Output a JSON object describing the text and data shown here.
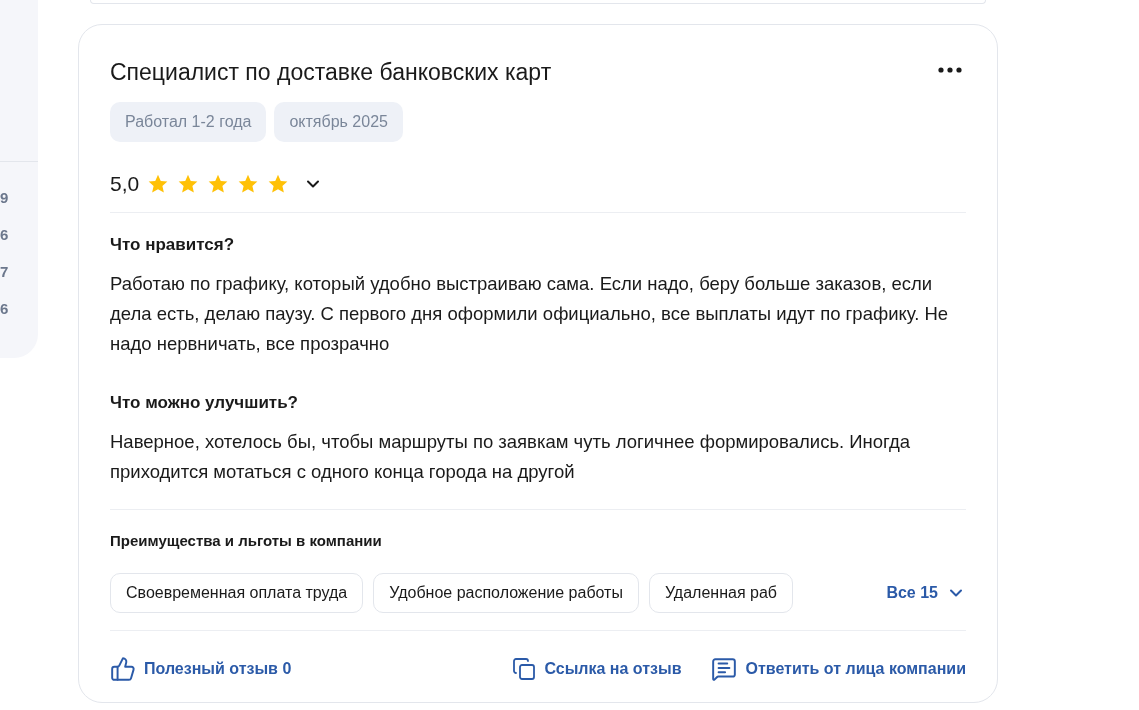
{
  "sidebar": {
    "counts": [
      "9",
      "6",
      "7",
      "6"
    ]
  },
  "review": {
    "title": "Специалист по доставке банковских карт",
    "tags": [
      "Работал 1-2 года",
      "октябрь 2025"
    ],
    "rating": "5,0",
    "stars": 5,
    "sections": [
      {
        "heading": "Что нравится?",
        "text": "Работаю по графику, который удобно выстраиваю сама. Если надо, беру больше заказов, если дела есть, делаю паузу. С первого дня оформили официально, все выплаты идут по графику. Не надо нервничать, все прозрачно"
      },
      {
        "heading": "Что можно улучшить?",
        "text": "Наверное, хотелось бы, чтобы маршруты по заявкам чуть логичнее формировались. Иногда приходится мотаться с одного конца города на другой"
      }
    ],
    "benefits": {
      "heading": "Преимущества и льготы в компании",
      "items": [
        "Своевременная оплата труда",
        "Удобное расположение работы",
        "Удаленная раб"
      ],
      "more": "Все 15"
    },
    "actions": [
      {
        "kind": "like",
        "label": "Полезный отзыв 0"
      },
      {
        "kind": "link",
        "label": "Ссылка на отзыв"
      },
      {
        "kind": "reply",
        "label": "Ответить от лица компании"
      }
    ]
  }
}
